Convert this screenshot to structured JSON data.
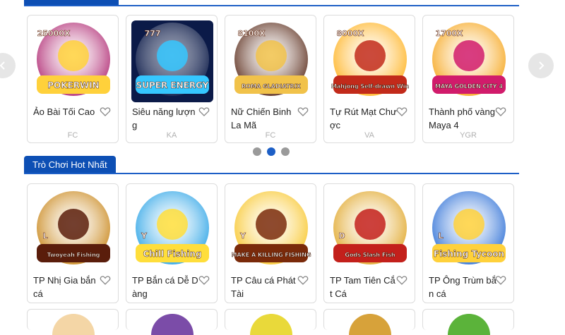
{
  "section2": {
    "title": "Trò Chơi Hot Nhất"
  },
  "carousel": {
    "page_count": 3,
    "active_page": 2
  },
  "row1": [
    {
      "name": "Ảo Bài Tối Cao",
      "provider": "FC",
      "logo": "POKERWIN",
      "badge": "25000X",
      "bg": "#b02a73",
      "accent": "#ffd13b",
      "icon": "clown-art-icon"
    },
    {
      "name": "Siêu năng lượng",
      "provider": "KA",
      "logo": "SUPER ENERGY",
      "badge": "777",
      "bg": "#0b1a48",
      "accent": "#35c7ff",
      "icon": "slot-777-art-icon"
    },
    {
      "name": "Nữ Chiến Binh La Mã",
      "provider": "FC",
      "logo": "ROMA GLADIATRIX",
      "badge": "8100X",
      "bg": "#5a2b1a",
      "accent": "#f1c24a",
      "icon": "gladiator-art-icon"
    },
    {
      "name": "Tự Rút Mạt Chược",
      "provider": "VA",
      "logo": "Mahjong Self-drawn Win",
      "badge": "8000X",
      "bg": "#ffb21f",
      "accent": "#c22a1a",
      "icon": "mahjong-art-icon"
    },
    {
      "name": "Thành phố vàng Maya 4",
      "provider": "YGR",
      "logo": "MAYA GOLDEN CITY 4",
      "badge": "1700X",
      "bg": "#f6a51a",
      "accent": "#d11b6b",
      "icon": "maya-art-icon"
    }
  ],
  "row2": [
    {
      "name": "TP Nhị Gia bắn cá",
      "logo": "Twoyeah Fishing",
      "badge": "L",
      "bg": "#c9871b",
      "accent": "#5a1d0b",
      "icon": "warrior-art-icon"
    },
    {
      "name": "TP Bắn cá Dễ Dàng",
      "logo": "Chill Fishing",
      "badge": "Y",
      "bg": "#2aa3e6",
      "accent": "#ffde3b",
      "icon": "shark-art-icon"
    },
    {
      "name": "TP Câu cá Phát Tài",
      "logo": "MAKE A KILLING FISHING",
      "badge": "Y",
      "bg": "#f8c62a",
      "accent": "#7a2a0a",
      "icon": "gold-burst-art-icon"
    },
    {
      "name": "TP Tam Tiên Cắt Cá",
      "logo": "Gods Slash Fish",
      "badge": "D",
      "bg": "#e0a627",
      "accent": "#c3201b",
      "icon": "god-of-wealth-art-icon"
    },
    {
      "name": "TP Ông Trùm bắn cá",
      "logo": "Fishing Tycoon",
      "badge": "L",
      "bg": "#2c6fd6",
      "accent": "#ffd13b",
      "icon": "tycoon-shark-art-icon"
    }
  ],
  "row3": [
    {
      "bg": "#f4d6a6"
    },
    {
      "bg": "#7b4ca8"
    },
    {
      "bg": "#e9d93a"
    },
    {
      "bg": "#d7a23a"
    },
    {
      "bg": "#5bb33a"
    }
  ]
}
